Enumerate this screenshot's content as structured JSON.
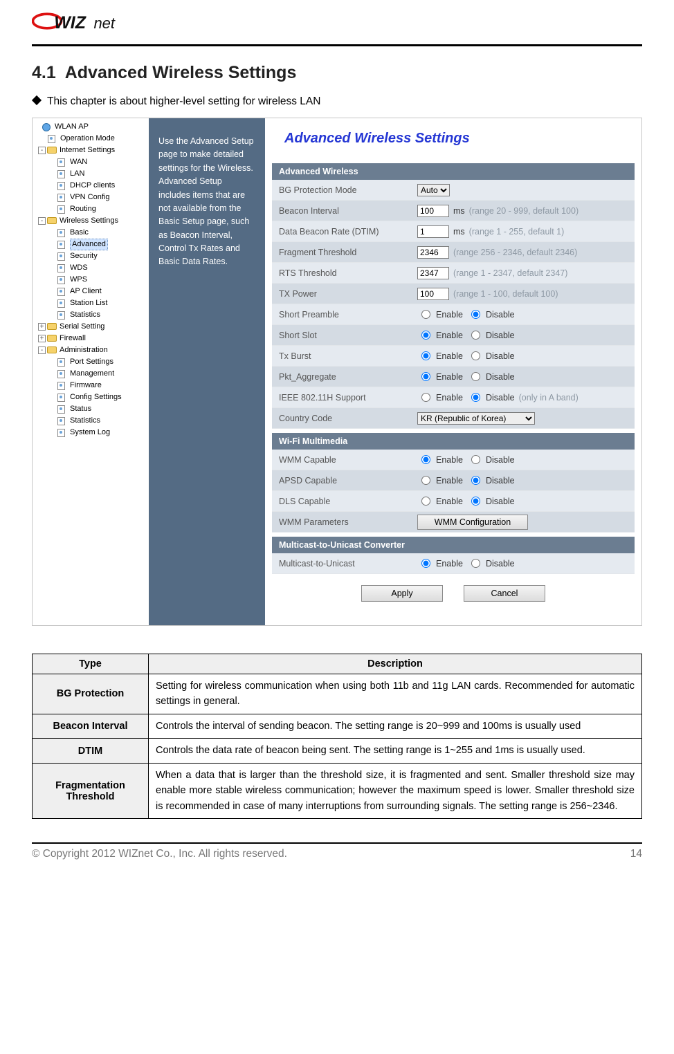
{
  "logo_text": "WIZnet",
  "section": {
    "num": "4.1",
    "title": "Advanced Wireless Settings"
  },
  "intro": "This chapter is about higher-level setting for wireless LAN",
  "tree": {
    "root": "WLAN AP",
    "groups": [
      {
        "label": "Operation Mode",
        "type": "page",
        "indent": 1
      },
      {
        "label": "Internet Settings",
        "type": "folder_open",
        "indent": 0,
        "box": "-"
      },
      {
        "label": "WAN",
        "type": "page",
        "indent": 2
      },
      {
        "label": "LAN",
        "type": "page",
        "indent": 2
      },
      {
        "label": "DHCP clients",
        "type": "page",
        "indent": 2
      },
      {
        "label": "VPN Config",
        "type": "page",
        "indent": 2
      },
      {
        "label": "Routing",
        "type": "page",
        "indent": 2
      },
      {
        "label": "Wireless Settings",
        "type": "folder_open",
        "indent": 0,
        "box": "-"
      },
      {
        "label": "Basic",
        "type": "page",
        "indent": 2
      },
      {
        "label": "Advanced",
        "type": "page",
        "indent": 2,
        "selected": true
      },
      {
        "label": "Security",
        "type": "page",
        "indent": 2
      },
      {
        "label": "WDS",
        "type": "page",
        "indent": 2
      },
      {
        "label": "WPS",
        "type": "page",
        "indent": 2
      },
      {
        "label": "AP Client",
        "type": "page",
        "indent": 2
      },
      {
        "label": "Station List",
        "type": "page",
        "indent": 2
      },
      {
        "label": "Statistics",
        "type": "page",
        "indent": 2
      },
      {
        "label": "Serial Setting",
        "type": "folder_closed",
        "indent": 0,
        "box": "+"
      },
      {
        "label": "Firewall",
        "type": "folder_closed",
        "indent": 0,
        "box": "+"
      },
      {
        "label": "Administration",
        "type": "folder_open",
        "indent": 0,
        "box": "-"
      },
      {
        "label": "Port Settings",
        "type": "page",
        "indent": 2
      },
      {
        "label": "Management",
        "type": "page",
        "indent": 2
      },
      {
        "label": "Firmware",
        "type": "page",
        "indent": 2
      },
      {
        "label": "Config Settings",
        "type": "page",
        "indent": 2
      },
      {
        "label": "Status",
        "type": "page",
        "indent": 2
      },
      {
        "label": "Statistics",
        "type": "page",
        "indent": 2
      },
      {
        "label": "System Log",
        "type": "page",
        "indent": 2
      }
    ]
  },
  "midcol_text": "Use the Advanced Setup page to make detailed settings for the Wireless. Advanced Setup includes items that are not available from the Basic Setup page, such as Beacon Interval, Control Tx Rates and Basic Data Rates.",
  "panel": {
    "title": "Advanced Wireless Settings",
    "sections": {
      "adv": {
        "header": "Advanced Wireless",
        "bg_protection": {
          "label": "BG Protection Mode",
          "select": "Auto"
        },
        "beacon_interval": {
          "label": "Beacon Interval",
          "value": "100",
          "unit": "ms",
          "hint": "(range 20 - 999, default 100)"
        },
        "dtim": {
          "label": "Data Beacon Rate (DTIM)",
          "value": "1",
          "unit": "ms",
          "hint": "(range 1 - 255, default 1)"
        },
        "frag": {
          "label": "Fragment Threshold",
          "value": "2346",
          "hint": "(range 256 - 2346, default 2346)"
        },
        "rts": {
          "label": "RTS Threshold",
          "value": "2347",
          "hint": "(range 1 - 2347, default 2347)"
        },
        "tx_power": {
          "label": "TX Power",
          "value": "100",
          "hint": "(range 1 - 100, default 100)"
        },
        "short_preamble": {
          "label": "Short Preamble",
          "enable": "Enable",
          "disable": "Disable",
          "checked": "disable"
        },
        "short_slot": {
          "label": "Short Slot",
          "enable": "Enable",
          "disable": "Disable",
          "checked": "enable"
        },
        "tx_burst": {
          "label": "Tx Burst",
          "enable": "Enable",
          "disable": "Disable",
          "checked": "enable"
        },
        "pkt_aggregate": {
          "label": "Pkt_Aggregate",
          "enable": "Enable",
          "disable": "Disable",
          "checked": "enable"
        },
        "ieee80211h": {
          "label": "IEEE 802.11H Support",
          "enable": "Enable",
          "disable": "Disable",
          "hint": "(only in A band)",
          "checked": "disable"
        },
        "country": {
          "label": "Country Code",
          "select": "KR (Republic of Korea)"
        }
      },
      "wmm": {
        "header": "Wi-Fi Multimedia",
        "wmm_capable": {
          "label": "WMM Capable",
          "enable": "Enable",
          "disable": "Disable",
          "checked": "enable"
        },
        "apsd_capable": {
          "label": "APSD Capable",
          "enable": "Enable",
          "disable": "Disable",
          "checked": "disable"
        },
        "dls_capable": {
          "label": "DLS Capable",
          "enable": "Enable",
          "disable": "Disable",
          "checked": "disable"
        },
        "wmm_params": {
          "label": "WMM Parameters",
          "button": "WMM Configuration"
        }
      },
      "mcast": {
        "header": "Multicast-to-Unicast Converter",
        "m2u": {
          "label": "Multicast-to-Unicast",
          "enable": "Enable",
          "disable": "Disable",
          "checked": "enable"
        }
      }
    },
    "buttons": {
      "apply": "Apply",
      "cancel": "Cancel"
    }
  },
  "table": {
    "headers": {
      "type": "Type",
      "desc": "Description"
    },
    "rows": [
      {
        "type": "BG Protection",
        "desc": "Setting for wireless communication when using both 11b and 11g LAN cards. Recommended for automatic settings in general."
      },
      {
        "type": "Beacon Interval",
        "desc": "Controls the interval of sending beacon. The setting range is 20~999 and 100ms is usually used"
      },
      {
        "type": "DTIM",
        "desc": "Controls the data rate of beacon being sent. The setting range is 1~255 and 1ms is usually used."
      },
      {
        "type": "Fragmentation Threshold",
        "desc": "When a data that is larger than the threshold size, it is fragmented and sent. Smaller threshold size may enable more stable wireless communication; however the maximum speed is lower. Smaller threshold size is recommended in case of many interruptions from surrounding signals. The setting range is 256~2346."
      }
    ]
  },
  "footer": {
    "copyright": "© Copyright 2012 WIZnet Co., Inc. All rights reserved.",
    "page": "14"
  }
}
